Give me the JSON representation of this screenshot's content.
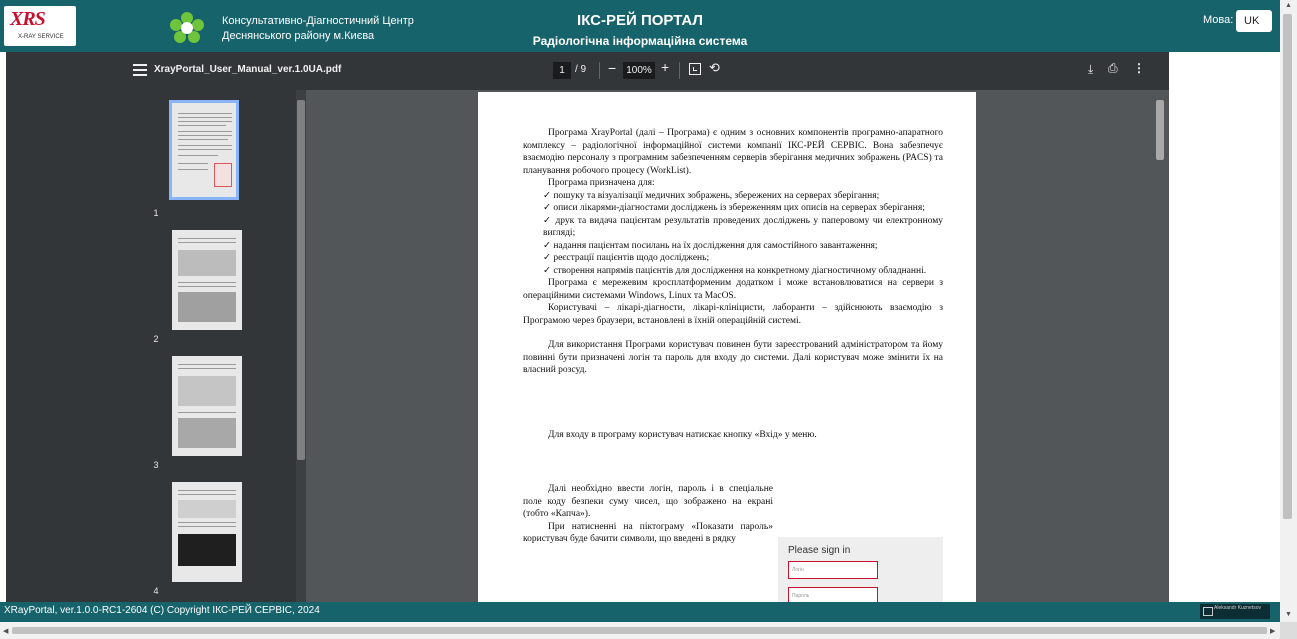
{
  "header": {
    "logo_text": "XRS",
    "logo_sub": "X-RAY SERVICE",
    "clinic_line1": "Консультативно-Діагностичний Центр",
    "clinic_line2": "Деснянського району м.Києва",
    "title": "ІКС-РЕЙ ПОРТАЛ",
    "subtitle": "Радіологічна інформаційна система",
    "lang_label": "Мова:",
    "lang_value": "UK"
  },
  "pdf_toolbar": {
    "filename": "XrayPortal_User_Manual_ver.1.0UA.pdf",
    "current_page": "1",
    "total_pages": "/ 9",
    "zoom": "100%",
    "zoom_out": "−",
    "zoom_in": "+"
  },
  "thumbnails": [
    {
      "label": "1",
      "active": true
    },
    {
      "label": "2",
      "active": false
    },
    {
      "label": "3",
      "active": false
    },
    {
      "label": "4",
      "active": false
    }
  ],
  "document": {
    "paragraphs": [
      {
        "style": "ind",
        "text": "Програма XrayPortal (далі – Програма) є одним з основних компонентів програмно-апаратного комплексу – радіологічної інформаційної системи компанії ІКС-РЕЙ СЕРВІС. Вона забезпечує взаємодію персоналу з програмним забезпеченням серверів зберігання медичних зображень (PACS) та планування робочого процесу (WorkList)."
      },
      {
        "style": "ind",
        "text": "Програма призначена для:"
      },
      {
        "style": "chk",
        "text": "✓     пошуку та візуалізації медичних зображень, збережених на серверах зберігання;"
      },
      {
        "style": "chk",
        "text": "✓     описи лікарями-діагностами досліджень із збереженням цих описів на серверах зберігання;"
      },
      {
        "style": "chk",
        "text": "✓     друк та видача пацієнтам результатів проведених досліджень у паперовому чи електронному вигляді;"
      },
      {
        "style": "chk",
        "text": "✓     надання пацієнтам посилань на їх дослідження для самостійного завантаження;"
      },
      {
        "style": "chk",
        "text": "✓     реєстрації пацієнтів щодо досліджень;"
      },
      {
        "style": "chk",
        "text": "✓     створення напрямів пацієнтів для дослідження на конкретному діагностичному обладнанні."
      },
      {
        "style": "ind",
        "text": "Програма є мережевим кросплатформеним додатком і може встановлюватися на сервери з операційними системами Windows, Linux та MacOS."
      },
      {
        "style": "ind",
        "text": "Користувачі – лікарі-діагности, лікарі-клініцисти, лаборанти – здійснюють взаємодію з Програмою через браузери, встановлені в їхній операційній системі."
      },
      {
        "style": "gap",
        "text": ""
      },
      {
        "style": "ind",
        "text": "Для використання Програми користувач повинен бути зареєстрований адміністратором та йому повинні бути призначені логін та пароль для входу до системи. Далі користувач може змінити їх на власний розсуд."
      },
      {
        "style": "gap-big",
        "text": ""
      },
      {
        "style": "ind",
        "text": "Для входу в програму користувач натискає кнопку «Вхід» у меню."
      },
      {
        "style": "gap-big2",
        "text": ""
      },
      {
        "style": "ind narrow",
        "text": "Далі необхідно ввести логін, пароль і в спеціальне поле коду безпеки суму чисел, що зображено на екрані (тобто «Капча»)."
      },
      {
        "style": "ind narrow",
        "text": "При натисненні на піктограму «Показати пароль» користувач буде бачити символи, що введені в рядку"
      }
    ],
    "sign_in": {
      "title": "Please sign in",
      "login_placeholder": "Логін",
      "password_placeholder": "Пароль"
    }
  },
  "footer": {
    "copyright": "XRayPortal, ver.1.0.0-RC1-2604 (C) Copyright ІКС-РЕЙ СЕРВІС, 2024",
    "badge": "Aleksandr Kuznetsov"
  },
  "colors": {
    "header_bg": "#17636b",
    "pdf_toolbar_bg": "#323639",
    "pdf_bg": "#525659",
    "accent_red": "#c8102e"
  }
}
